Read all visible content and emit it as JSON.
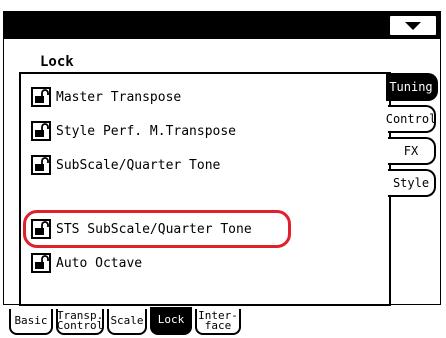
{
  "header": {
    "title": "",
    "dropdown_icon": "triangle-down-icon"
  },
  "section_title": "Lock",
  "items": [
    {
      "label": "Master Transpose",
      "icon": "lock-open-icon"
    },
    {
      "label": "Style Perf. M.Transpose",
      "icon": "lock-open-icon"
    },
    {
      "label": "SubScale/Quarter Tone",
      "icon": "lock-open-icon"
    },
    {
      "label": "STS SubScale/Quarter Tone",
      "icon": "lock-open-icon",
      "highlighted": true
    },
    {
      "label": "Auto Octave",
      "icon": "lock-open-icon"
    }
  ],
  "side_tabs": [
    {
      "label": "Tuning",
      "active": true
    },
    {
      "label": "Control",
      "active": false
    },
    {
      "label": "FX",
      "active": false
    },
    {
      "label": "Style",
      "active": false
    }
  ],
  "bottom_tabs": [
    {
      "label": "Basic",
      "active": false
    },
    {
      "label": "Transp.\nControl",
      "active": false
    },
    {
      "label": "Scale",
      "active": false
    },
    {
      "label": "Lock",
      "active": true
    },
    {
      "label": "Inter-\nface",
      "active": false
    }
  ],
  "colors": {
    "highlight": "#e0202a",
    "background": "#ffffff",
    "foreground": "#000000"
  }
}
